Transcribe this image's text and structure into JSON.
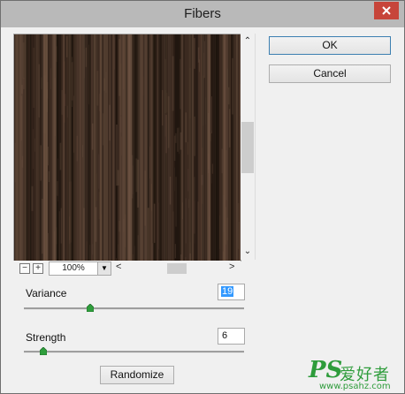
{
  "dialog": {
    "title": "Fibers"
  },
  "preview": {
    "zoom": "100%"
  },
  "buttons": {
    "ok": "OK",
    "cancel": "Cancel",
    "randomize": "Randomize"
  },
  "variance": {
    "label": "Variance",
    "value": "19",
    "slider_level": 0.3
  },
  "strength": {
    "label": "Strength",
    "value": "6",
    "slider_level": 0.09
  },
  "watermark": {
    "ps": "PS",
    "cn": "爱好者",
    "url": "www.psahz.com"
  },
  "colors": {
    "fiber_base": "#3b2a20",
    "fiber_dark": "#1b120c",
    "fiber_light": "#6e5443",
    "slider_thumb": "#2f9e3c"
  }
}
